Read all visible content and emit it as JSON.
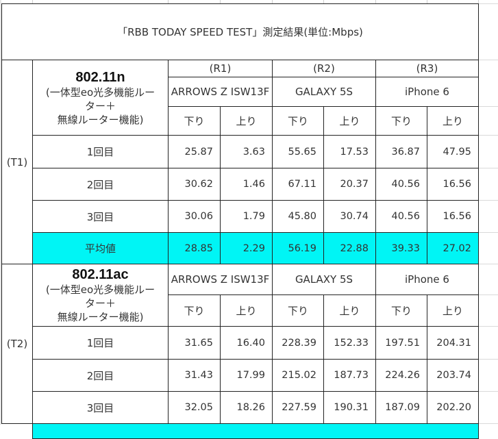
{
  "title": "「RBB TODAY SPEED TEST」測定結果(単位:Mbps)",
  "router_labels": [
    "(R1)",
    "(R2)",
    "(R3)"
  ],
  "devices": [
    "ARROWS Z ISW13F",
    "GALAXY 5S",
    "iPhone 6"
  ],
  "direction_labels": {
    "down": "下り",
    "up": "上り"
  },
  "sections": [
    {
      "id": "(T1)",
      "standard": "802.11n",
      "router_desc_line1": "(一体型eo光多機能ルー",
      "router_desc_line2": "ター＋",
      "router_desc_line3": "無線ルーター機能)",
      "rows": [
        {
          "label": "1回目",
          "values": [
            "25.87",
            "3.63",
            "55.65",
            "17.53",
            "36.87",
            "47.95"
          ]
        },
        {
          "label": "2回目",
          "values": [
            "30.62",
            "1.46",
            "67.11",
            "20.37",
            "40.56",
            "16.56"
          ]
        },
        {
          "label": "3回目",
          "values": [
            "30.06",
            "1.79",
            "45.80",
            "30.74",
            "40.56",
            "16.56"
          ]
        }
      ],
      "average": {
        "label": "平均値",
        "values": [
          "28.85",
          "2.29",
          "56.19",
          "22.88",
          "39.33",
          "27.02"
        ]
      }
    },
    {
      "id": "(T2)",
      "standard": "802.11ac",
      "router_desc_line1": "(一体型eo光多機能ルー",
      "router_desc_line2": "ター＋",
      "router_desc_line3": "無線ルーター機能)",
      "rows": [
        {
          "label": "1回目",
          "values": [
            "31.65",
            "16.40",
            "228.39",
            "152.33",
            "197.51",
            "204.31"
          ]
        },
        {
          "label": "2回目",
          "values": [
            "31.43",
            "17.99",
            "215.02",
            "187.73",
            "224.26",
            "203.74"
          ]
        },
        {
          "label": "3回目",
          "values": [
            "32.05",
            "18.26",
            "227.59",
            "190.31",
            "187.09",
            "202.20"
          ]
        }
      ]
    }
  ],
  "colors": {
    "average_highlight": "#00f5f5",
    "border": "#222222"
  }
}
